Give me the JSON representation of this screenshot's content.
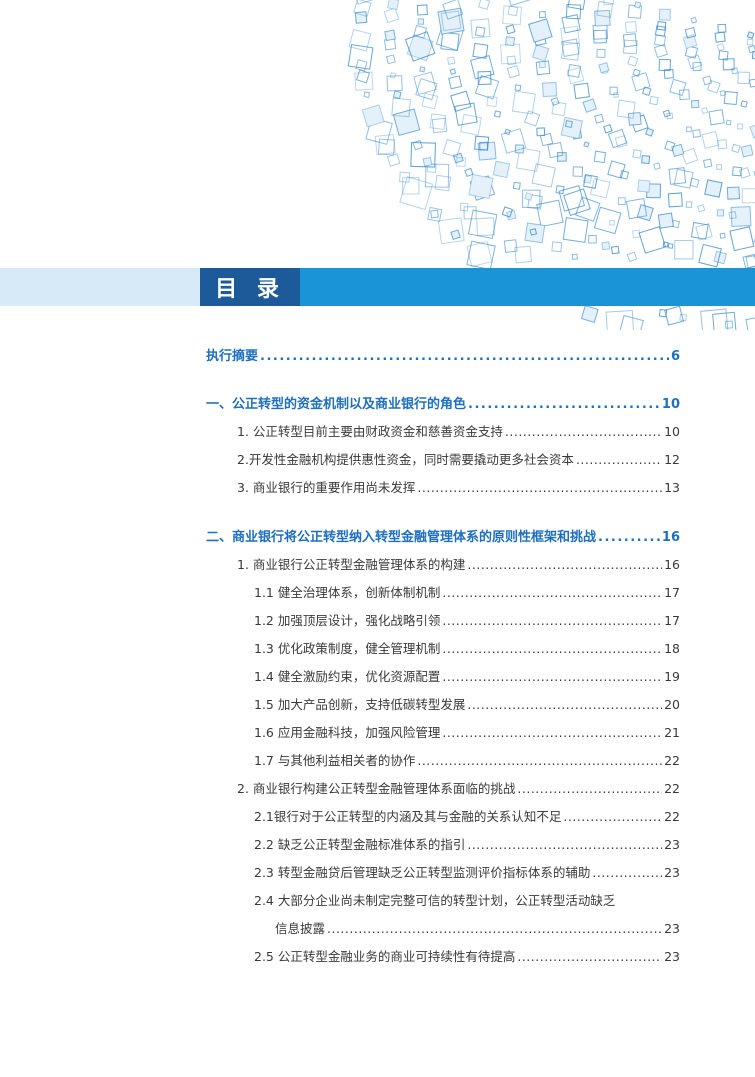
{
  "header": {
    "title": "目 录"
  },
  "toc": {
    "executive_summary": {
      "label": "执行摘要",
      "page": "6"
    },
    "ch1": {
      "label": "一、公正转型的资金机制以及商业银行的角色",
      "page": "10"
    },
    "ch1_1": {
      "label": "1. 公正转型目前主要由财政资金和慈善资金支持",
      "page": "10"
    },
    "ch1_2": {
      "label": "2.开发性金融机构提供惠性资金，同时需要撬动更多社会资本",
      "page": "12"
    },
    "ch1_3": {
      "label": "3. 商业银行的重要作用尚未发挥",
      "page": "13"
    },
    "ch2": {
      "label": "二、商业银行将公正转型纳入转型金融管理体系的原则性框架和挑战",
      "page": "16"
    },
    "ch2_1": {
      "label": "1. 商业银行公正转型金融管理体系的构建",
      "page": "16"
    },
    "ch2_1_1": {
      "label": "1.1 健全治理体系，创新体制机制",
      "page": "17"
    },
    "ch2_1_2": {
      "label": "1.2 加强顶层设计，强化战略引领",
      "page": "17"
    },
    "ch2_1_3": {
      "label": "1.3 优化政策制度，健全管理机制",
      "page": "18"
    },
    "ch2_1_4": {
      "label": "1.4 健全激励约束，优化资源配置",
      "page": "19"
    },
    "ch2_1_5": {
      "label": "1.5 加大产品创新，支持低碳转型发展",
      "page": "20"
    },
    "ch2_1_6": {
      "label": "1.6 应用金融科技，加强风险管理",
      "page": "21"
    },
    "ch2_1_7": {
      "label": "1.7 与其他利益相关者的协作",
      "page": "22"
    },
    "ch2_2": {
      "label": "2. 商业银行构建公正转型金融管理体系面临的挑战",
      "page": "22"
    },
    "ch2_2_1": {
      "label": "2.1银行对于公正转型的内涵及其与金融的关系认知不足",
      "page": "22"
    },
    "ch2_2_2": {
      "label": "2.2 缺乏公正转型金融标准体系的指引",
      "page": "23"
    },
    "ch2_2_3": {
      "label": "2.3 转型金融贷后管理缺乏公正转型监测评价指标体系的辅助",
      "page": "23"
    },
    "ch2_2_4": {
      "label": "2.4 大部分企业尚未制定完整可信的转型计划，公正转型活动缺乏",
      "label_cont": "信息披露",
      "page": "23"
    },
    "ch2_2_5": {
      "label": "2.5 公正转型金融业务的商业可持续性有待提高",
      "page": "23"
    }
  },
  "colors": {
    "title_bg": "#1d5a9a",
    "band_right": "#1a94d6",
    "band_left": "#d6ebf7",
    "heading_text": "#1e6fc0",
    "pattern": "#3f8fd0"
  }
}
